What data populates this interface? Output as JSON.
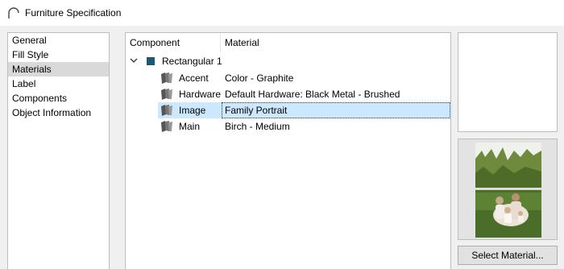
{
  "window": {
    "title": "Furniture Specification"
  },
  "left_list": {
    "items": [
      {
        "label": "General"
      },
      {
        "label": "Fill Style"
      },
      {
        "label": "Materials",
        "selected": true
      },
      {
        "label": "Label"
      },
      {
        "label": "Components"
      },
      {
        "label": "Object Information"
      }
    ]
  },
  "tree": {
    "headers": {
      "component": "Component",
      "material": "Material"
    },
    "group": {
      "label": "Rectangular 1",
      "color": "#1b5878"
    },
    "rows": [
      {
        "component": "Accent",
        "material": "Color - Graphite"
      },
      {
        "component": "Hardware",
        "material": "Default Hardware: Black Metal - Brushed"
      },
      {
        "component": "Image",
        "material": "Family Portrait",
        "selected": true
      },
      {
        "component": "Main",
        "material": "Birch - Medium"
      }
    ]
  },
  "buttons": {
    "select_material": "Select Material..."
  }
}
